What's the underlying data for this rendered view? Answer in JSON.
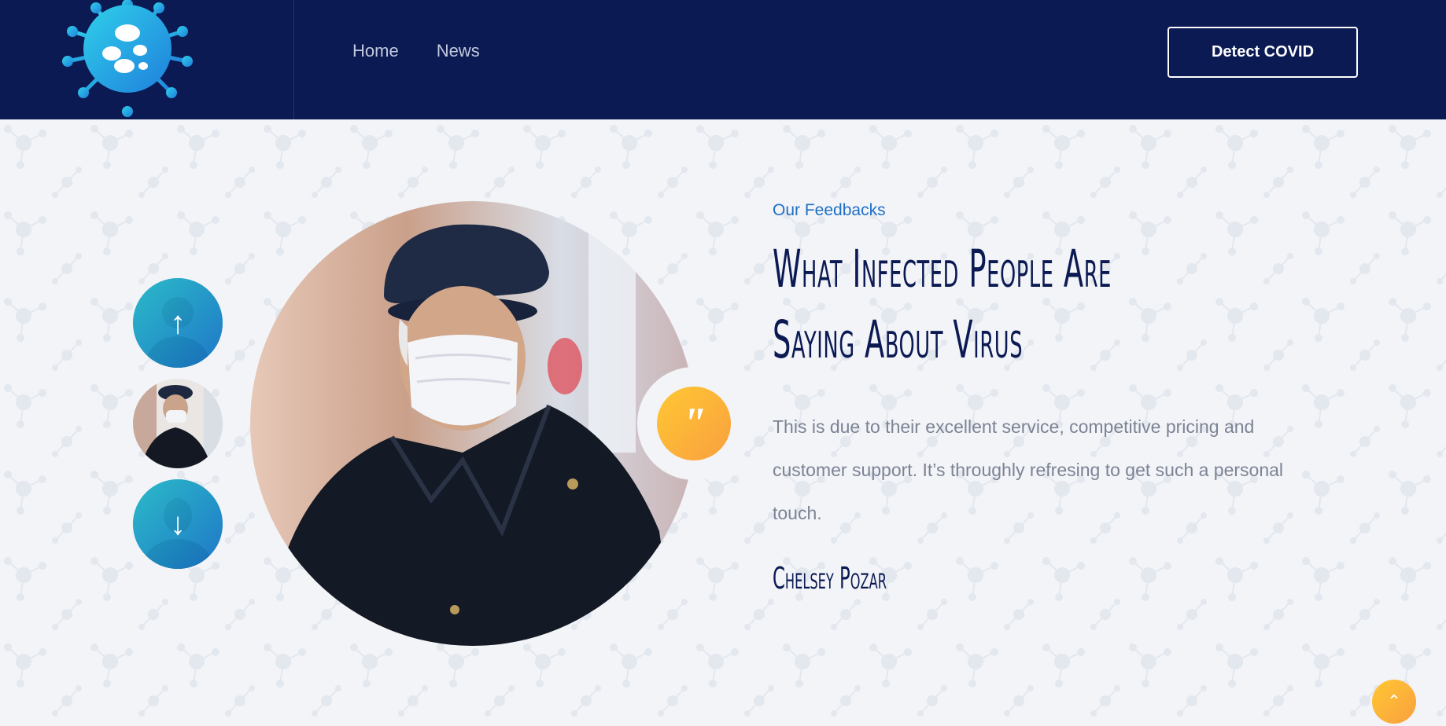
{
  "header": {
    "logo_icon": "virus-logo-icon",
    "nav": [
      {
        "label": "Home"
      },
      {
        "label": "News"
      }
    ],
    "cta_label": "Detect COVID"
  },
  "testimonial": {
    "eyebrow": "Our Feedbacks",
    "headline_line1": "What Infected People Are",
    "headline_line2": "Saying About Virus",
    "quote": "This is due to their excellent service, competitive pricing and customer support. It’s throughly refresing to get such a personal touch.",
    "author": "Chelsey Pozar",
    "quote_icon": "quote-icon",
    "thumbnails": [
      {
        "icon": "arrow-up-icon",
        "glyph": "↑"
      },
      {
        "icon": "person-thumb"
      },
      {
        "icon": "arrow-down-icon",
        "glyph": "↓"
      }
    ]
  },
  "scroll_top": {
    "icon": "chevron-up-icon",
    "glyph": "⌃"
  },
  "colors": {
    "navy": "#0b1a52",
    "accent_blue": "#1f6fc5",
    "accent_yellow": "#ffc733",
    "text_gray": "#7c8394"
  }
}
